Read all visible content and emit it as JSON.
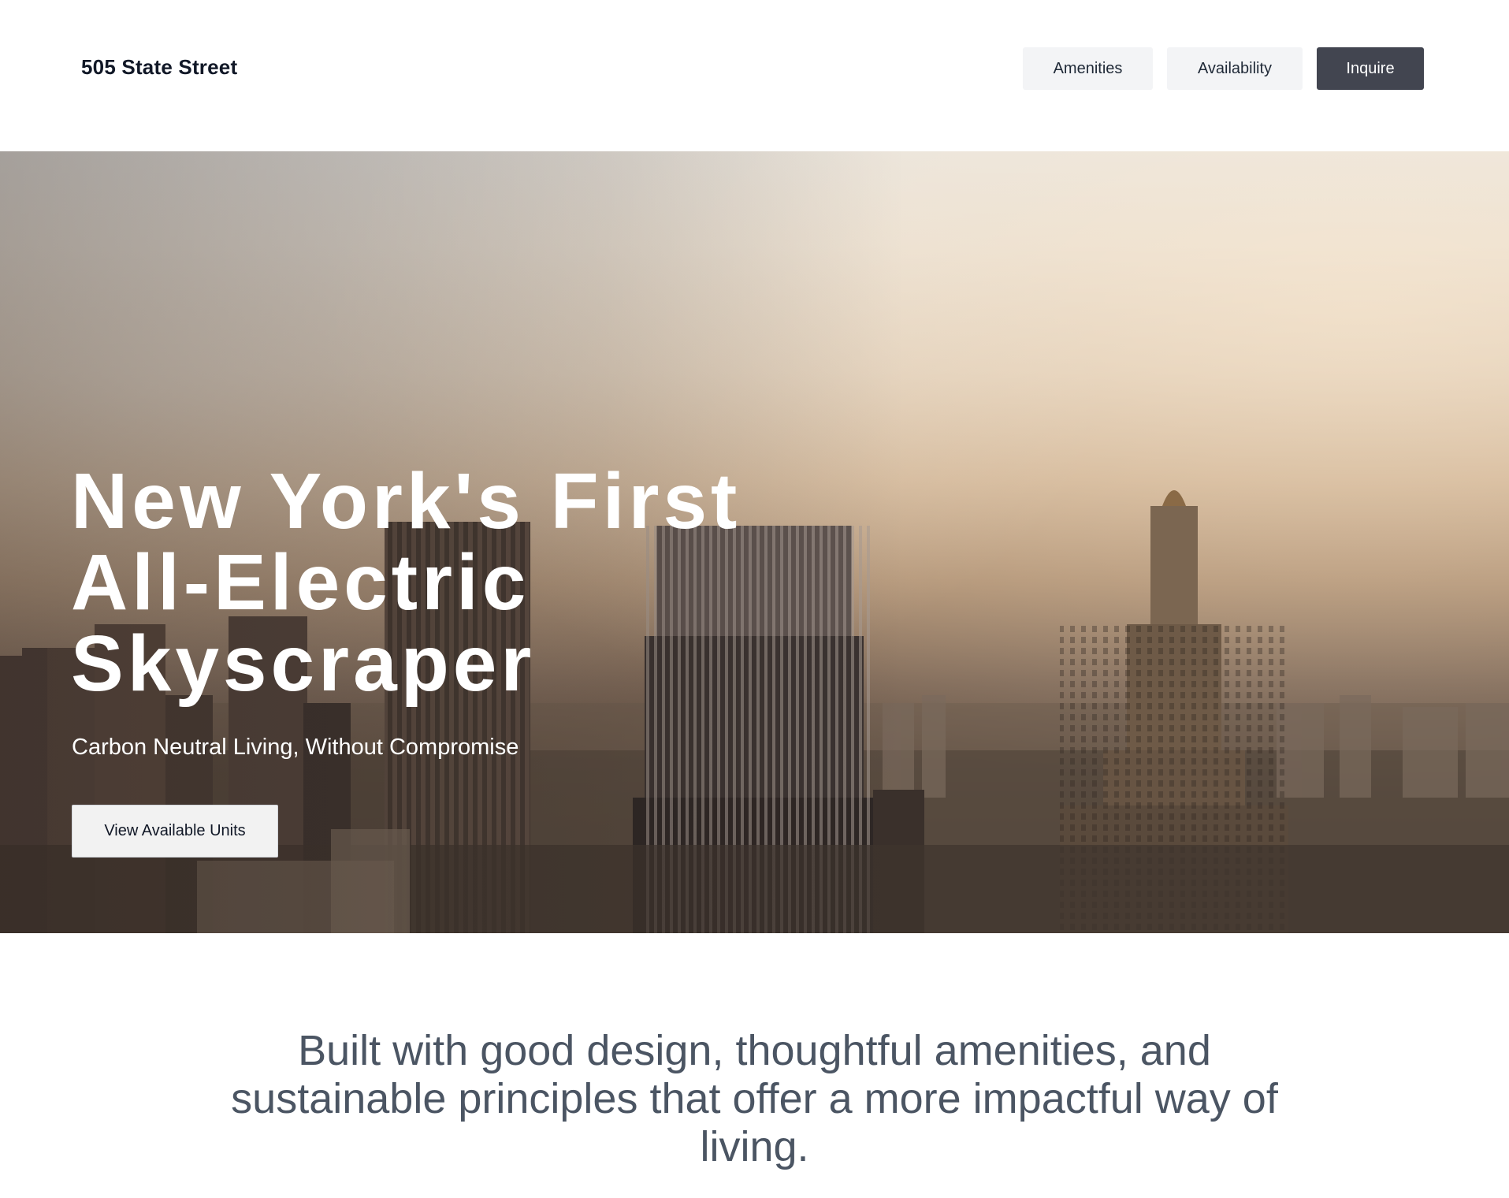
{
  "header": {
    "brand": "505 State Street",
    "nav": {
      "amenities": "Amenities",
      "availability": "Availability",
      "inquire": "Inquire"
    }
  },
  "hero": {
    "title_lines": [
      "New York's First",
      "All-Electric",
      "Skyscraper"
    ],
    "subtitle": "Carbon Neutral Living, Without Compromise",
    "cta_label": "View Available Units"
  },
  "intro": {
    "text": "Built with good design, thoughtful amenities, and sustainable principles that offer a more impactful way of living."
  },
  "colors": {
    "nav_light_bg": "#f3f4f6",
    "nav_dark_bg": "#424550",
    "intro_text": "#4b5563",
    "hero_text": "#ffffff"
  }
}
